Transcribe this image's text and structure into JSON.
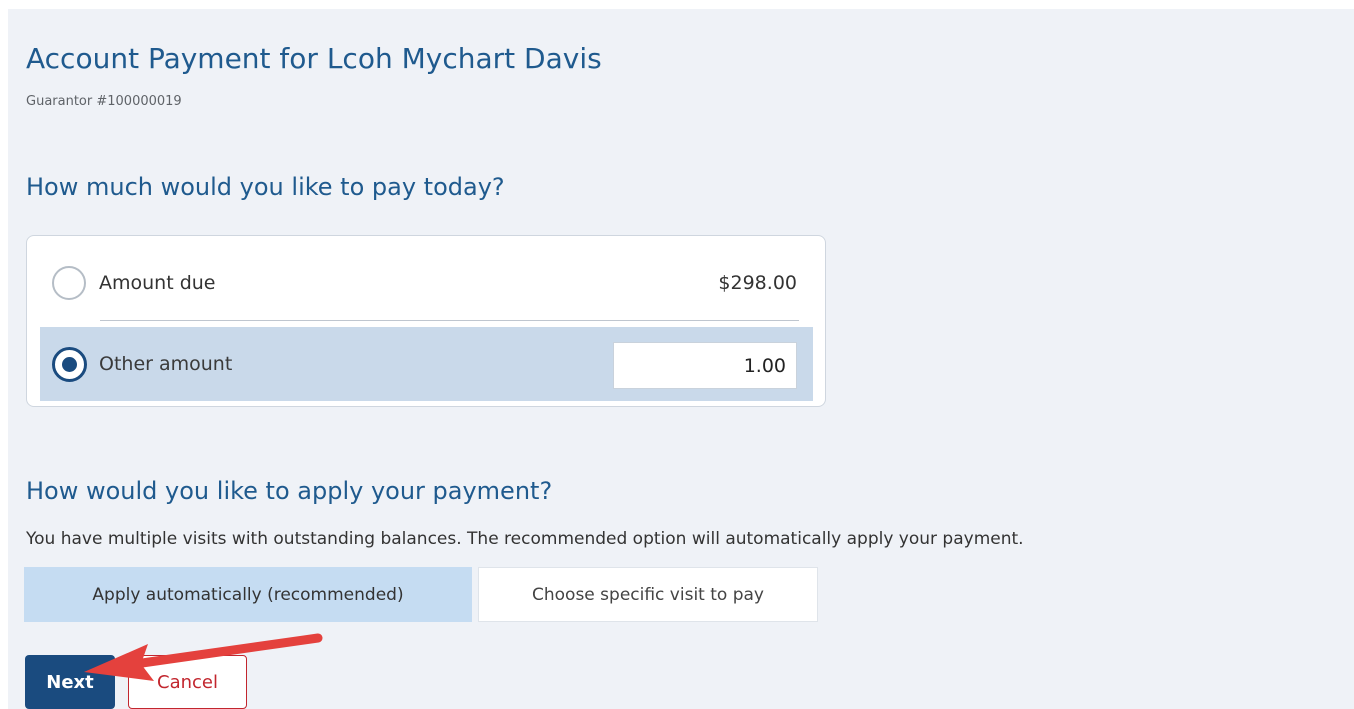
{
  "header": {
    "title": "Account Payment for Lcoh Mychart Davis",
    "guarantor": "Guarantor #100000019"
  },
  "amount_section": {
    "heading": "How much would you like to pay today?",
    "options": [
      {
        "label": "Amount due",
        "value": "$298.00",
        "selected": false
      },
      {
        "label": "Other amount",
        "value": "1.00",
        "selected": true
      }
    ]
  },
  "apply_section": {
    "heading": "How would you like to apply your payment?",
    "description": "You have multiple visits with outstanding balances. The recommended option will automatically apply your payment.",
    "choices": [
      {
        "label": "Apply automatically (recommended)",
        "selected": true
      },
      {
        "label": "Choose specific visit to pay",
        "selected": false
      }
    ]
  },
  "actions": {
    "next_label": "Next",
    "cancel_label": "Cancel"
  },
  "colors": {
    "heading": "#1f5a8e",
    "primary_button": "#1a4b7f",
    "selected_option": "#c9d9ea",
    "selected_toggle": "#c5dcf2",
    "cancel": "#c2262e",
    "annotation_arrow": "#e4413d"
  },
  "icons": {
    "annotation": "red-arrow-icon"
  }
}
